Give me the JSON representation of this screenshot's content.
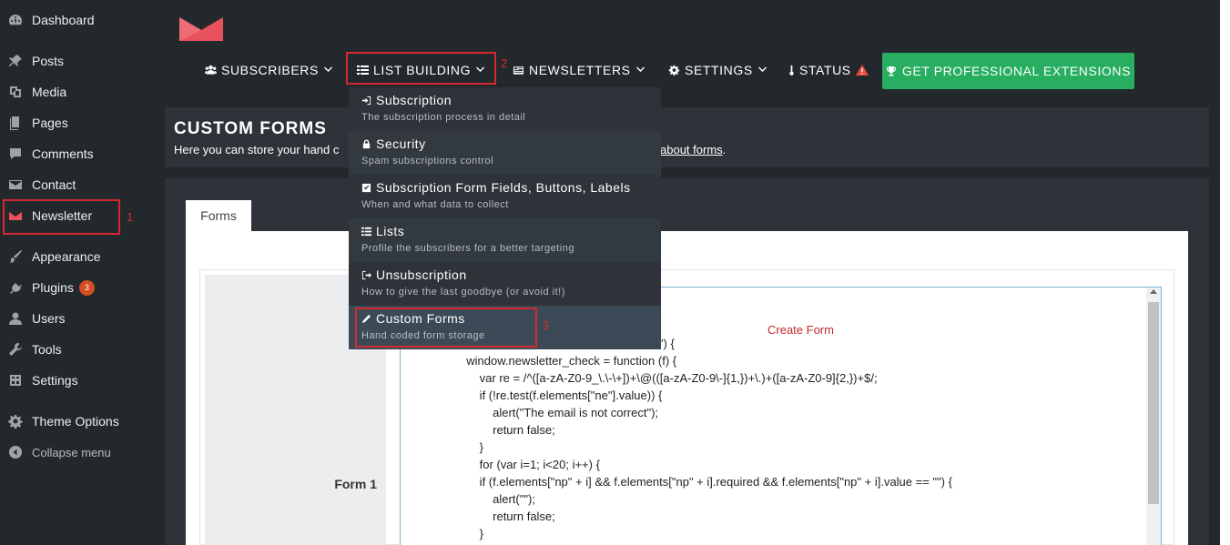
{
  "sidebar": {
    "items": [
      {
        "label": "Dashboard",
        "icon": "dashboard-icon"
      },
      {
        "label": "Posts",
        "icon": "pin-icon"
      },
      {
        "label": "Media",
        "icon": "media-icon"
      },
      {
        "label": "Pages",
        "icon": "pages-icon"
      },
      {
        "label": "Comments",
        "icon": "comment-icon"
      },
      {
        "label": "Contact",
        "icon": "mail-icon"
      },
      {
        "label": "Newsletter",
        "icon": "newsletter-icon"
      },
      {
        "label": "Appearance",
        "icon": "brush-icon"
      },
      {
        "label": "Plugins",
        "icon": "plug-icon",
        "badge": "3"
      },
      {
        "label": "Users",
        "icon": "user-icon"
      },
      {
        "label": "Tools",
        "icon": "wrench-icon"
      },
      {
        "label": "Settings",
        "icon": "settings-icon"
      },
      {
        "label": "Theme Options",
        "icon": "gear-icon"
      },
      {
        "label": "Collapse menu",
        "icon": "collapse-icon"
      }
    ]
  },
  "nav": {
    "subscribers": "SUBSCRIBERS",
    "list_building": "LIST BUILDING",
    "newsletters": "NEWSLETTERS",
    "settings": "SETTINGS",
    "status": "STATUS",
    "pro": "GET PROFESSIONAL EXTENSIONS"
  },
  "dropdown": {
    "items": [
      {
        "title": "Subscription",
        "desc": "The subscription process in detail",
        "icon": "sign-in-icon"
      },
      {
        "title": "Security",
        "desc": "Spam subscriptions control",
        "icon": "lock-icon"
      },
      {
        "title": "Subscription Form Fields, Buttons, Labels",
        "desc": "When and what data to collect",
        "icon": "checkbox-icon"
      },
      {
        "title": "Lists",
        "desc": "Profile the subscribers for a better targeting",
        "icon": "list-icon"
      },
      {
        "title": "Unsubscription",
        "desc": "How to give the last goodbye (or avoid it!)",
        "icon": "sign-out-icon"
      },
      {
        "title": "Custom Forms",
        "desc": "Hand coded form storage",
        "icon": "pencil-icon"
      }
    ]
  },
  "header": {
    "title": "CUSTOM FORMS",
    "subtitle_start": "Here you can store your hand c",
    "subtitle_link": "about forms",
    "subtitle_end": "."
  },
  "body": {
    "tab": "Forms",
    "form_label": "Form 1",
    "code": "                                                                  function\") {\n                    window.newsletter_check = function (f) {\n                        var re = /^([a-zA-Z0-9_\\.\\-\\+])+\\@(([a-zA-Z0-9\\-]{1,})+\\.)+([a-zA-Z0-9]{2,})+$/;\n                        if (!re.test(f.elements[\"ne\"].value)) {\n                            alert(\"The email is not correct\");\n                            return false;\n                        }\n                        for (var i=1; i<20; i++) {\n                        if (f.elements[\"np\" + i] && f.elements[\"np\" + i].required && f.elements[\"np\" + i].value == \"\") {\n                            alert(\"\");\n                            return false;\n                        }\n                        }"
  },
  "annotations": {
    "note": "Create Form",
    "label1": "1",
    "label2": "2",
    "label3": "3"
  },
  "colors": {
    "accent_green": "#27ae60",
    "annotation_red": "#d42a2f",
    "logo_red": "#e8525d",
    "badge_orange": "#d54e21"
  }
}
